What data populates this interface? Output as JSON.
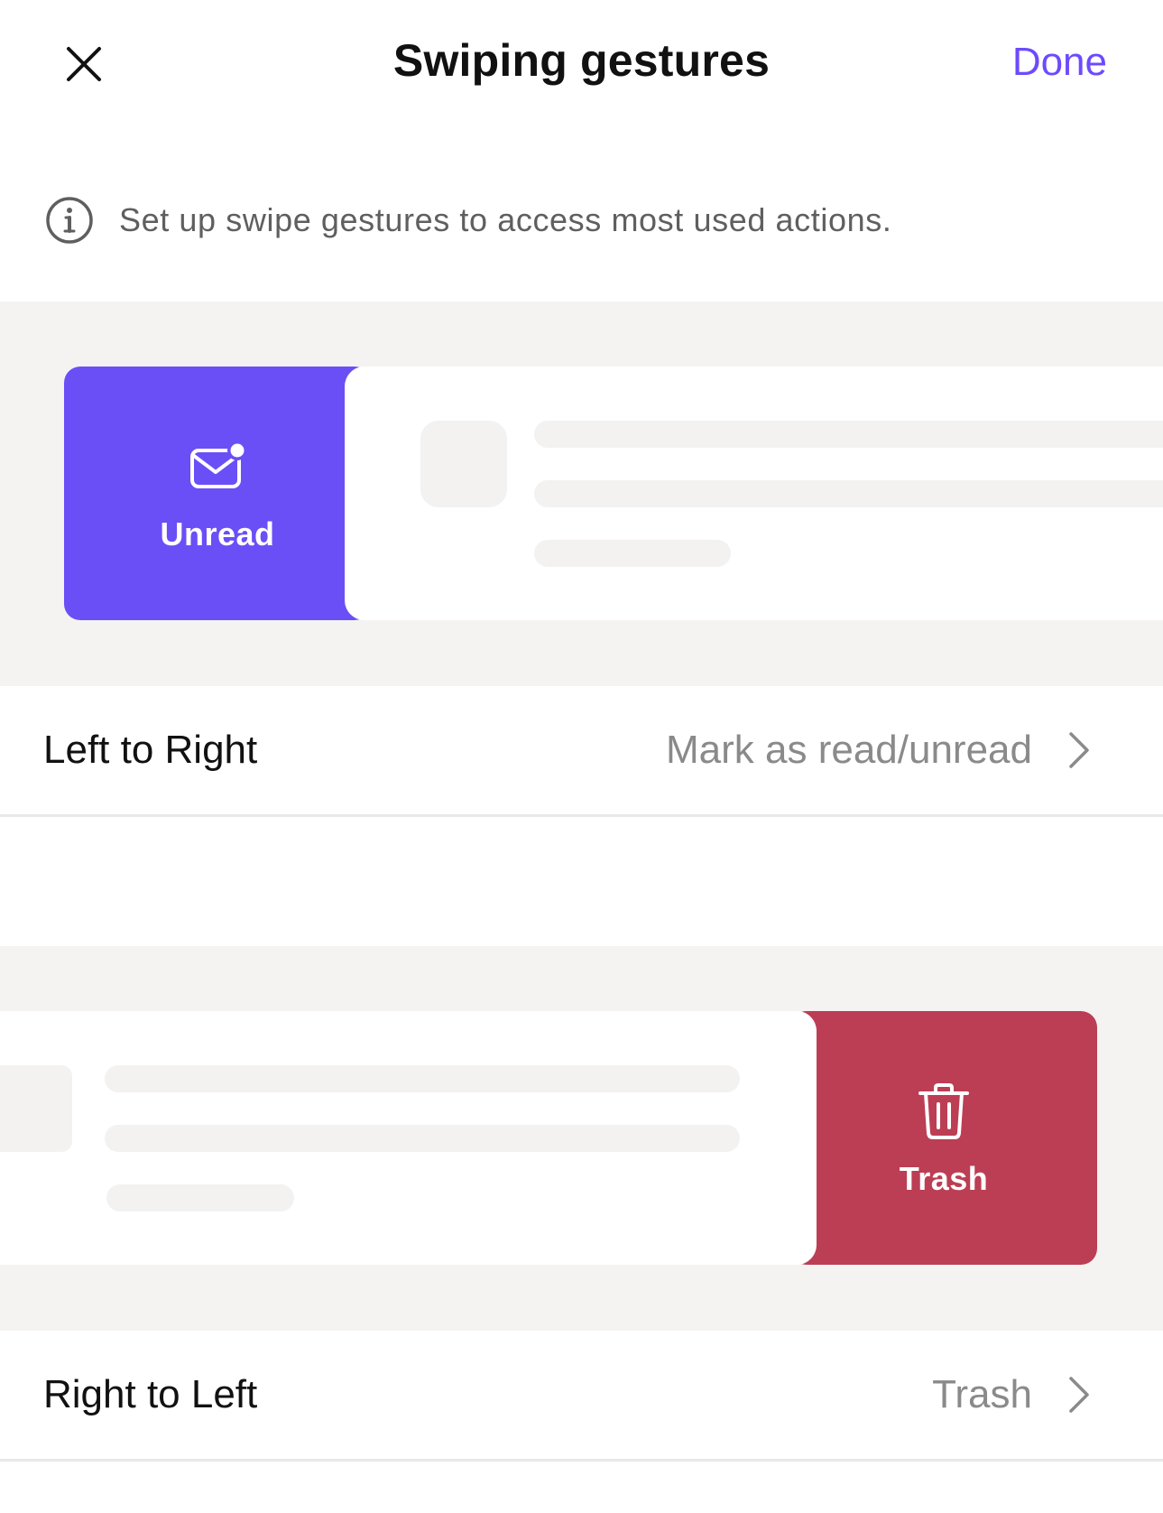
{
  "header": {
    "title": "Swiping gestures",
    "done_label": "Done",
    "close_icon": "close-icon"
  },
  "info": {
    "icon": "info-icon",
    "text": "Set up swipe gestures to access most used actions."
  },
  "previews": {
    "left_to_right": {
      "action_label": "Unread",
      "action_icon": "envelope-unread-icon",
      "color": "#6a4ff7"
    },
    "right_to_left": {
      "action_label": "Trash",
      "action_icon": "trash-icon",
      "color": "#bc3e54"
    }
  },
  "settings": [
    {
      "label": "Left to Right",
      "value": "Mark as read/unread",
      "icon": "chevron-right-icon"
    },
    {
      "label": "Right to Left",
      "value": "Trash",
      "icon": "chevron-right-icon"
    }
  ],
  "colors": {
    "accent": "#6d4aff",
    "preview_background": "#f4f3f2",
    "placeholder": "#f3f2f1"
  }
}
